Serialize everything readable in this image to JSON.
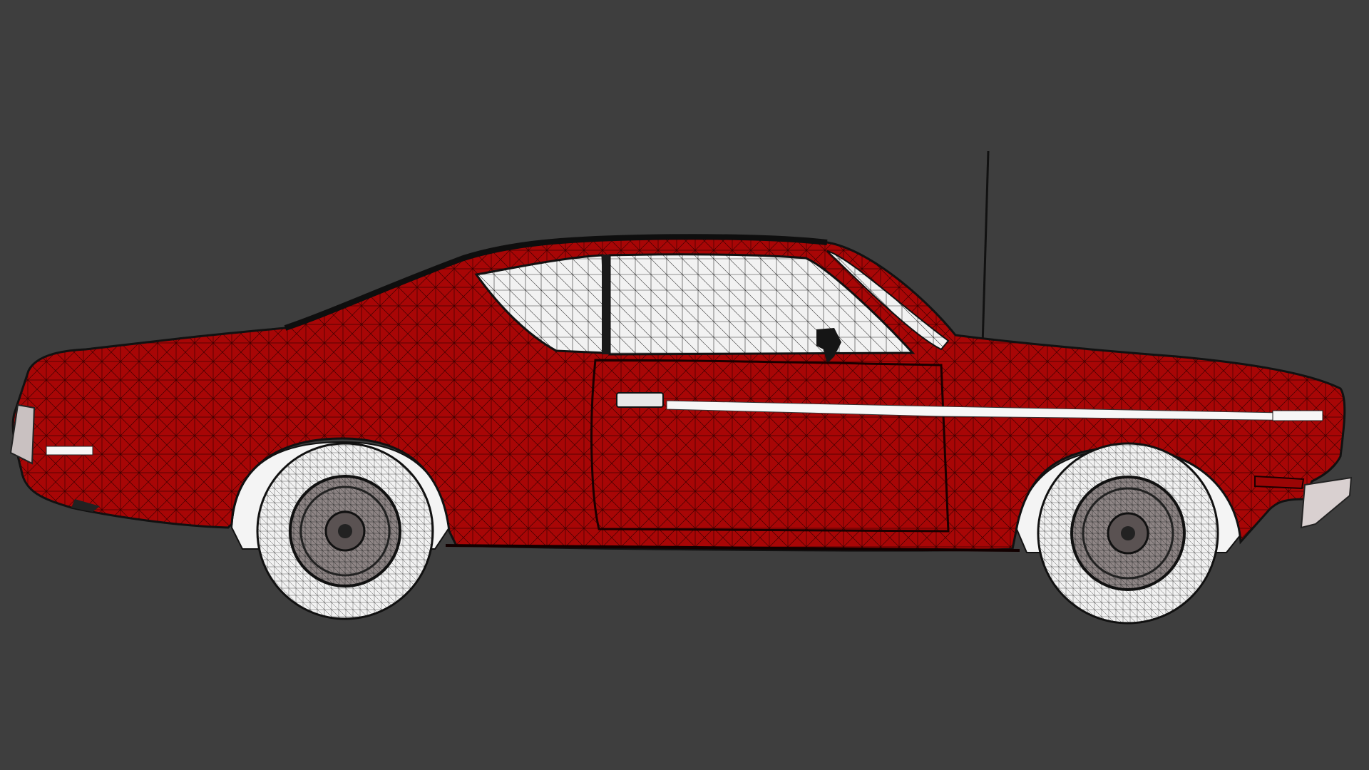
{
  "viewport": {
    "background_color": "#3e3e3e",
    "render_mode": "wireframe-on-shaded",
    "view": "side"
  },
  "model": {
    "subject": "car",
    "body_color": "#a80606",
    "wire_color": "#1a1a1a",
    "tire_color": "#f2f2f2",
    "rim_color": "#8e8585",
    "glass_color": "#f2f2f2",
    "trim_color": "#ffffff"
  }
}
